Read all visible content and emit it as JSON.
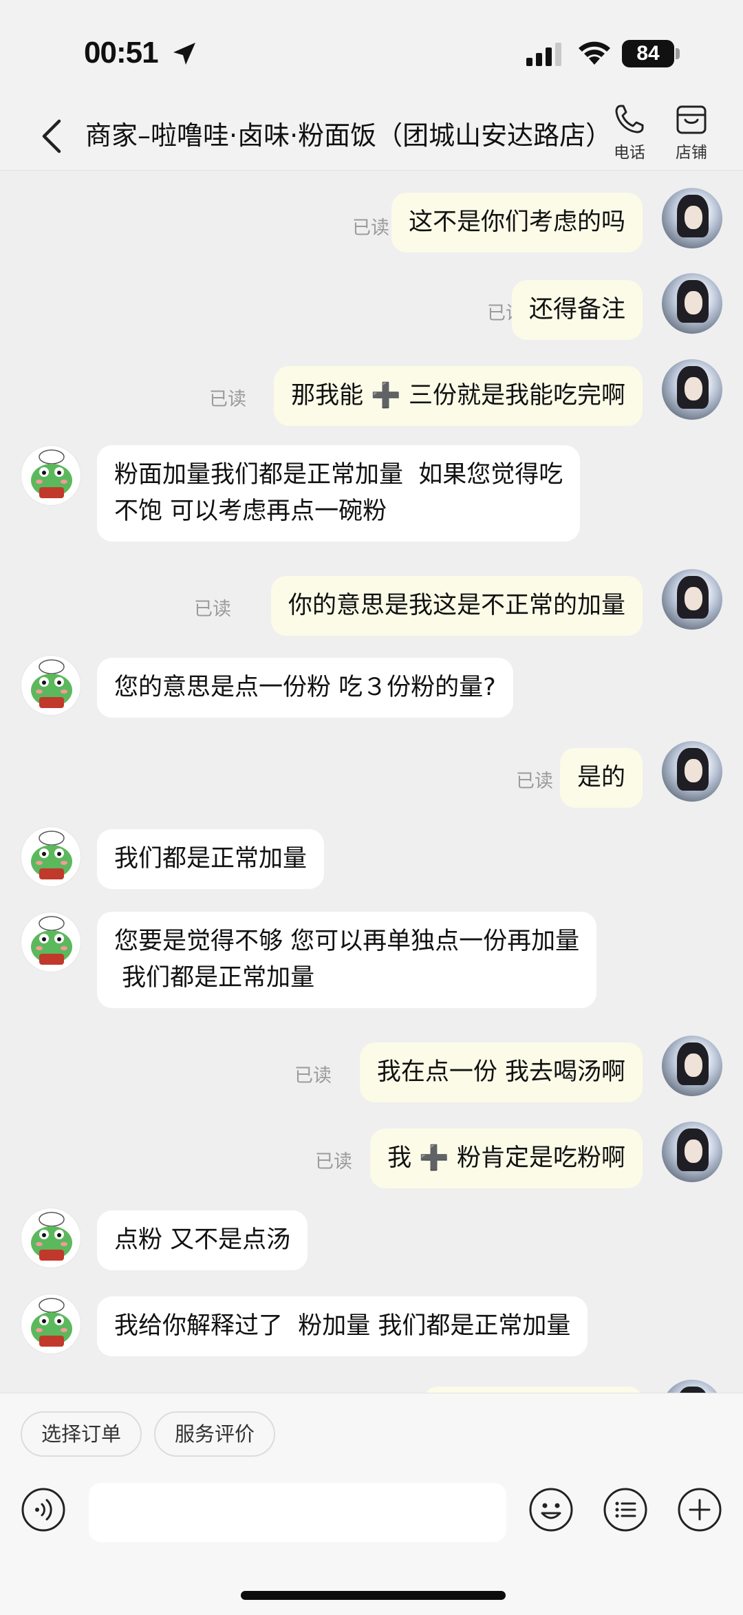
{
  "status_bar": {
    "time": "00:51",
    "battery": "84"
  },
  "header": {
    "title": "商家–啦噜哇·卤味·粉面饭（团城山安达路店）",
    "phone_label": "电话",
    "shop_label": "店铺"
  },
  "colors": {
    "background": "#efeff0",
    "sent_bubble": "#fbfbe8",
    "received_bubble": "#ffffff",
    "read_tag": "#9b9b9b"
  },
  "messages": [
    {
      "side": "sent",
      "text": "这不是你们考虑的吗",
      "read": "已读"
    },
    {
      "side": "sent",
      "text": "还得备注",
      "read": "已读"
    },
    {
      "side": "sent",
      "text": "那我能 ➕ 三份就是我能吃完啊",
      "read": "已读"
    },
    {
      "side": "received",
      "text": "粉面加量我们都是正常加量  如果您觉得吃\n不饱 可以考虑再点一碗粉"
    },
    {
      "side": "sent",
      "text": "你的意思是我这是不正常的加量",
      "read": "已读"
    },
    {
      "side": "received",
      "text": "您的意思是点一份粉 吃３份粉的量?"
    },
    {
      "side": "sent",
      "text": "是的",
      "read": "已读"
    },
    {
      "side": "received",
      "text": "我们都是正常加量"
    },
    {
      "side": "received",
      "text": "您要是觉得不够 您可以再单独点一份再加量\n 我们都是正常加量"
    },
    {
      "side": "sent",
      "text": "我在点一份 我去喝汤啊",
      "read": "已读"
    },
    {
      "side": "sent",
      "text": "我 ➕ 粉肯定是吃粉啊",
      "read": "已读"
    },
    {
      "side": "received",
      "text": "点粉 又不是点汤"
    },
    {
      "side": "received",
      "text": "我给你解释过了  粉加量 我们都是正常加量"
    }
  ],
  "quick_actions": [
    "选择订单",
    "服务评价"
  ],
  "input": {
    "value": "",
    "placeholder": ""
  },
  "icons": {
    "back": "chevron-left-icon",
    "phone": "phone-icon",
    "shop": "shop-icon",
    "voice": "voice-icon",
    "emoji": "emoji-icon",
    "list": "list-icon",
    "plus": "plus-icon"
  }
}
